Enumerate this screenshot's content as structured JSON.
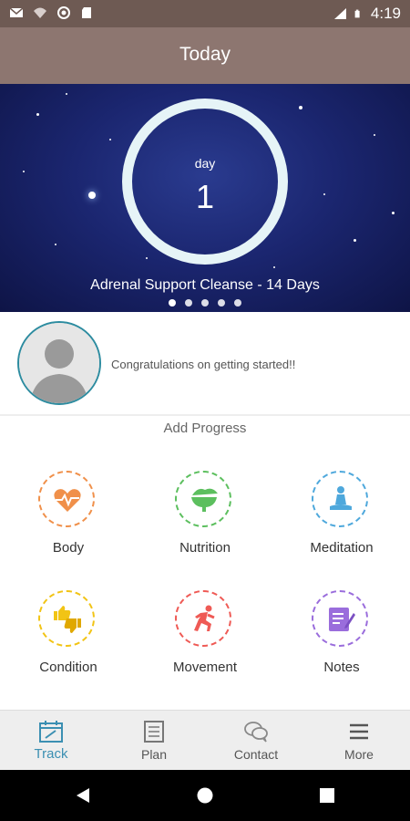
{
  "status_bar": {
    "time": "4:19",
    "network": "LTE"
  },
  "app_bar": {
    "title": "Today"
  },
  "hero": {
    "day_label": "day",
    "day_number": "1",
    "program_title": "Adrenal Support Cleanse - 14 Days",
    "page_count": 5,
    "active_page": 1
  },
  "message": {
    "text": "Congratulations on getting started!!"
  },
  "add_progress": {
    "title": "Add Progress",
    "items": [
      {
        "label": "Body",
        "icon": "heart-pulse-icon",
        "color": "#f0904a"
      },
      {
        "label": "Nutrition",
        "icon": "food-bowl-icon",
        "color": "#5cbf5e"
      },
      {
        "label": "Meditation",
        "icon": "meditation-icon",
        "color": "#4ea8dc"
      },
      {
        "label": "Condition",
        "icon": "thumbs-up-down-icon",
        "color": "#f2c415"
      },
      {
        "label": "Movement",
        "icon": "running-icon",
        "color": "#ef5a55"
      },
      {
        "label": "Notes",
        "icon": "notes-icon",
        "color": "#9a6ddc"
      }
    ]
  },
  "bottom_nav": {
    "items": [
      {
        "label": "Track",
        "icon": "calendar-icon",
        "active": true
      },
      {
        "label": "Plan",
        "icon": "list-icon",
        "active": false
      },
      {
        "label": "Contact",
        "icon": "chat-icon",
        "active": false
      },
      {
        "label": "More",
        "icon": "menu-icon",
        "active": false
      }
    ],
    "active_color": "#3b8fb2"
  },
  "colors": {
    "status_bar": "#6e5a53",
    "app_bar": "#8d7670",
    "ring": "#e6f4f7",
    "avatar_border": "#2d8ca0"
  }
}
